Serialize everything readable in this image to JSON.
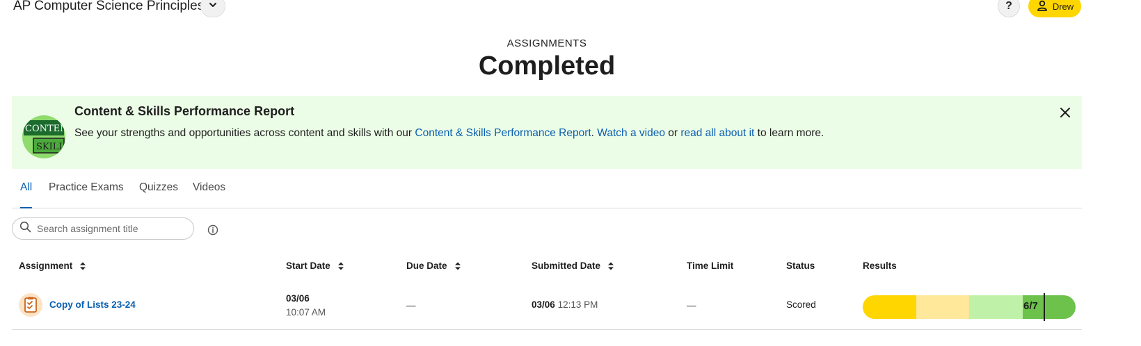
{
  "header": {
    "course_title": "AP Computer Science Principles",
    "help_label": "?",
    "user_name": "Drew",
    "user_button_color": "#ffd600"
  },
  "page": {
    "section_label": "ASSIGNMENTS",
    "title": "Completed"
  },
  "banner": {
    "logo_text_top": "CONTEN",
    "logo_text_bottom": "SKILL",
    "title": "Content & Skills Performance Report",
    "text_prefix": "See your strengths and opportunities across content and skills with our ",
    "link_report": "Content & Skills Performance Report",
    "text_after_report": ". ",
    "link_video": "Watch a video",
    "text_or": " or ",
    "link_read": "read all about it",
    "text_suffix": " to learn more.",
    "background_color": "#ecfde7",
    "link_color": "#0a5fb0"
  },
  "tabs": [
    {
      "label": "All",
      "active": true
    },
    {
      "label": "Practice Exams",
      "active": false
    },
    {
      "label": "Quizzes",
      "active": false
    },
    {
      "label": "Videos",
      "active": false
    }
  ],
  "search": {
    "placeholder": "Search assignment title",
    "value": ""
  },
  "table": {
    "columns": [
      "Assignment",
      "Start Date",
      "Due Date",
      "Submitted Date",
      "Time Limit",
      "Status",
      "Results"
    ],
    "rows": [
      {
        "assignment": "Copy of Lists 23-24",
        "start_date": "03/06",
        "start_time": "10:07 AM",
        "due_date": "—",
        "submitted_date": "03/06",
        "submitted_time": "12:13 PM",
        "time_limit": "—",
        "status": "Scored",
        "result": "6/7",
        "result_fraction": 0.857,
        "result_band_colors": [
          "#ffd600",
          "#ffe89a",
          "#bff2a8",
          "#6cc24a"
        ]
      }
    ]
  }
}
